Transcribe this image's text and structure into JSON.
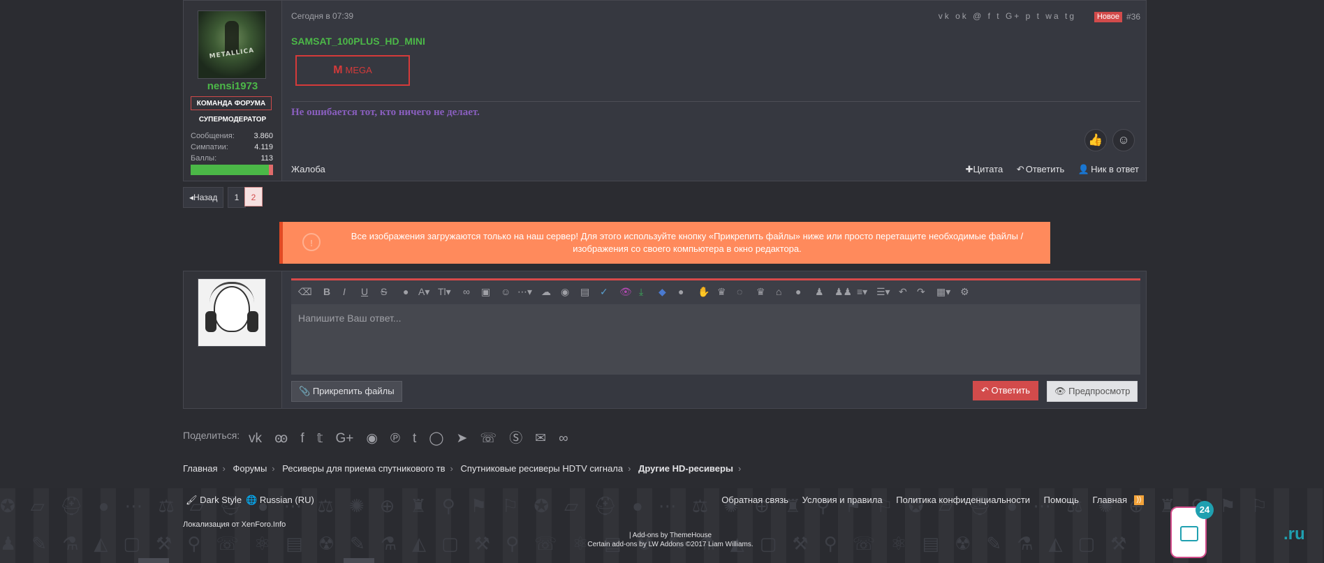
{
  "post": {
    "date": "Сегодня в 07:39",
    "share_icons": "vk ok @ f t G+ p t wa tg",
    "new_badge": "Новое",
    "post_number": "#36",
    "title": "SAMSAT_100PLUS_HD_MINI",
    "mega_label": "MEGA",
    "mega_logo": "M",
    "signature": "Не ошибается тот, кто ничего не делает.",
    "report": "Жалоба",
    "actions": {
      "quote": "Цитата",
      "reply": "Ответить",
      "nick": "Ник в ответ"
    }
  },
  "user": {
    "name": "nensi1973",
    "team_badge": "КОМАНДА ФОРУМА",
    "role": "СУПЕРМОДЕРАТОР",
    "stats": [
      {
        "label": "Сообщения:",
        "value": "3.860"
      },
      {
        "label": "Симпатии:",
        "value": "4.119"
      },
      {
        "label": "Баллы:",
        "value": "113"
      }
    ],
    "points_bar_fill": 0.95,
    "avatar_text": "METALLICA"
  },
  "pagination": {
    "back": "Назад",
    "pages": [
      "1",
      "2"
    ],
    "current": "2"
  },
  "notice": {
    "icon": "!",
    "text": "Все изображения загружаются только на наш сервер! Для этого используйте кнопку «Прикрепить файлы» ниже или просто перетащите необходимые файлы / изображения со своего компьютера в окно редактора."
  },
  "editor": {
    "placeholder": "Напишите Ваш ответ...",
    "attach": "Прикрепить файлы",
    "submit": "Ответить",
    "preview": "Предпросмотр"
  },
  "share": {
    "label": "Поделиться:",
    "icons": [
      "vk",
      "ok",
      "facebook",
      "twitter",
      "google-plus",
      "reddit",
      "pinterest",
      "tumblr",
      "whatsapp",
      "telegram",
      "viber",
      "skype",
      "email",
      "link"
    ]
  },
  "breadcrumb": [
    "Главная",
    "Форумы",
    "Ресиверы для приема спутникового тв",
    "Спутниковые ресиверы HDTV сигнала",
    "Другие HD-ресиверы"
  ],
  "footer": {
    "style": "Dark Style",
    "language": "Russian (RU)",
    "links": [
      "Обратная связь",
      "Условия и правила",
      "Политика конфиденциальности",
      "Помощь",
      "Главная"
    ],
    "localization": "Локализация от XenForo.Info",
    "addons_line1": "| Add-ons by ThemeHouse",
    "addons_line2": "Certain add-ons by LW Addons ©2017 Liam Williams.",
    "widget_count": "24",
    "widget_domain": ".ru"
  },
  "colors": {
    "accent_red": "#d24b4b",
    "green": "#4cb848",
    "notice": "#ff8a5c",
    "signature": "#8a5fbf"
  }
}
